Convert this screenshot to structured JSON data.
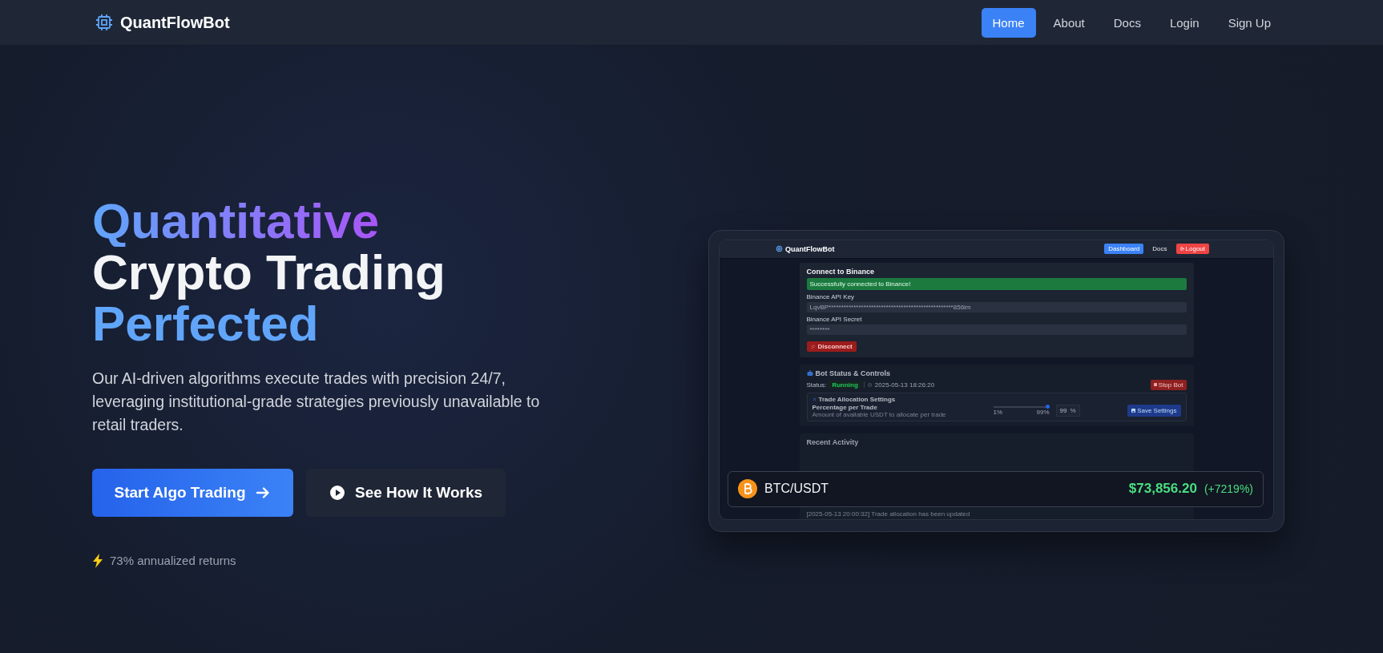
{
  "nav": {
    "brand": "QuantFlowBot",
    "links": [
      {
        "label": "Home",
        "selected": true
      },
      {
        "label": "About",
        "selected": false
      },
      {
        "label": "Docs",
        "selected": false
      },
      {
        "label": "Login",
        "selected": false
      },
      {
        "label": "Sign Up",
        "selected": false
      }
    ]
  },
  "hero": {
    "title_lines": [
      {
        "text": "Quantitative",
        "kind": "gradient"
      },
      {
        "text": "Crypto Trading",
        "kind": "plain"
      },
      {
        "text": "Perfected",
        "kind": "accent"
      }
    ],
    "description": "Our AI-driven algorithms execute trades with precision 24/7, leveraging institutional-grade strategies previously unavailable to retail traders.",
    "buttons": [
      {
        "label": "Start Algo Trading",
        "kind": "primary"
      },
      {
        "label": "See How It Works",
        "kind": "secondary"
      }
    ],
    "stat": "73% annualized returns"
  },
  "preview": {
    "brand": "QuantFlowBot",
    "nav": [
      {
        "label": "Dashboard",
        "kind": "primary"
      },
      {
        "label": "Docs",
        "kind": "link"
      },
      {
        "label": "Logout",
        "kind": "danger"
      }
    ],
    "connect": {
      "title": "Connect to Binance",
      "alert": "Successfully connected to Binance!",
      "fields": [
        {
          "label": "Binance API Key",
          "value": "LqvBP**************************************************856im"
        },
        {
          "label": "Binance API Secret",
          "value": "********"
        }
      ],
      "button": "Disconnect"
    },
    "bot": {
      "title": "Bot Status & Controls",
      "status_label": "Status:",
      "status": "Running",
      "timestamp": "2025-05-13 18:26:20",
      "stop_button": "Stop Bot",
      "allocation": {
        "title": "Trade Allocation Settings",
        "label": "Percentage per Trade",
        "hint": "Amount of available USDT to allocate per trade",
        "min": "1%",
        "max": "99%",
        "level": 1,
        "value": "99",
        "unit": "%",
        "save": "Save Settings"
      }
    },
    "activity": {
      "title": "Recent Activity",
      "entries": [
        "[2025-05-13 20:00:32] Trade allocation has been updated"
      ]
    },
    "ticker": {
      "pair": "BTC/USDT",
      "price": "$73,856.20",
      "change": "(+7219%)"
    }
  }
}
